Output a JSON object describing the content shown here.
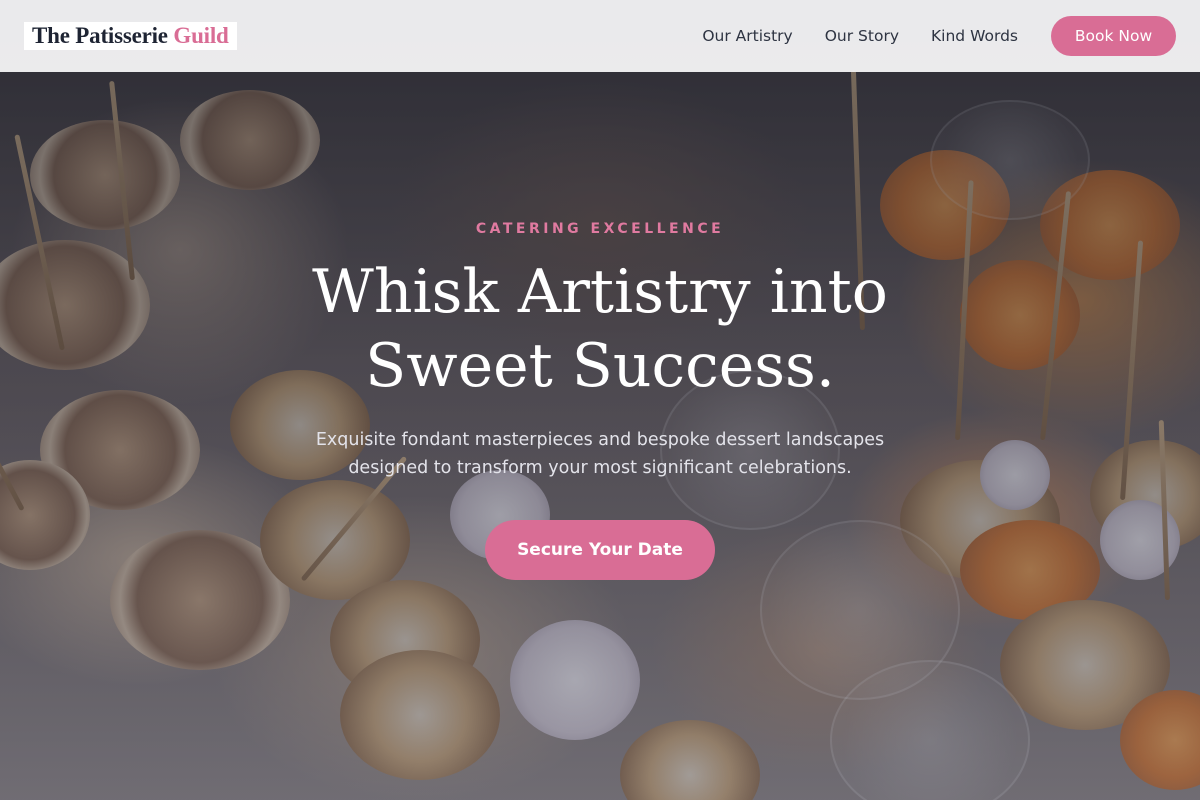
{
  "brand": {
    "name_primary": "The Patisserie",
    "name_accent": "Guild",
    "accent_color": "#d96d95",
    "text_color": "#1e2433"
  },
  "nav": {
    "links": [
      "Our Artistry",
      "Our Story",
      "Kind Words"
    ],
    "cta_label": "Book Now"
  },
  "hero": {
    "eyebrow": "CATERING EXCELLENCE",
    "headline_line1": "Whisk Artistry into",
    "headline_line2": "Sweet Success.",
    "subtitle_line1": "Exquisite fondant masterpieces and bespoke dessert landscapes",
    "subtitle_line2": "designed to transform your most significant celebrations.",
    "cta_label": "Secure Your Date",
    "background_image": "catering-desserts-photo"
  }
}
